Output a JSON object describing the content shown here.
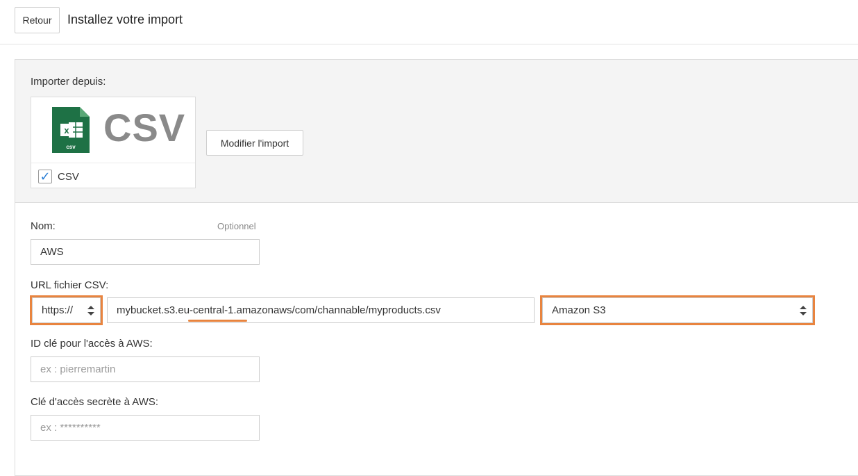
{
  "header": {
    "back_label": "Retour",
    "title": "Installez votre import"
  },
  "source": {
    "label": "Importer depuis:",
    "card_logo_text": "CSV",
    "file_icon_caption": "csv",
    "file_icon_letter": "x",
    "checkbox_checked": true,
    "checkbox_label": "CSV",
    "modify_label": "Modifier l'import"
  },
  "form": {
    "name_label": "Nom:",
    "name_optional": "Optionnel",
    "name_value": "AWS",
    "url_label": "URL fichier CSV:",
    "protocol_value": "https://",
    "url_value": "mybucket.s3.eu-central-1.amazonaws/com/channable/myproducts.csv",
    "url_value_pre": "mybucket.s3.",
    "url_value_mid": "eu-central-1",
    "url_value_post": ".amazonaws/com/channable/myproducts.csv",
    "storage_value": "Amazon S3",
    "aws_key_id_label": "ID clé pour l'accès à AWS:",
    "aws_key_id_placeholder": "ex : pierremartin",
    "aws_secret_label": "Clé d'accès secrète à AWS:",
    "aws_secret_placeholder": "ex : **********"
  },
  "colors": {
    "highlight": "#e8843f",
    "excel_green": "#1e7145",
    "check_blue": "#2a7fd6"
  }
}
